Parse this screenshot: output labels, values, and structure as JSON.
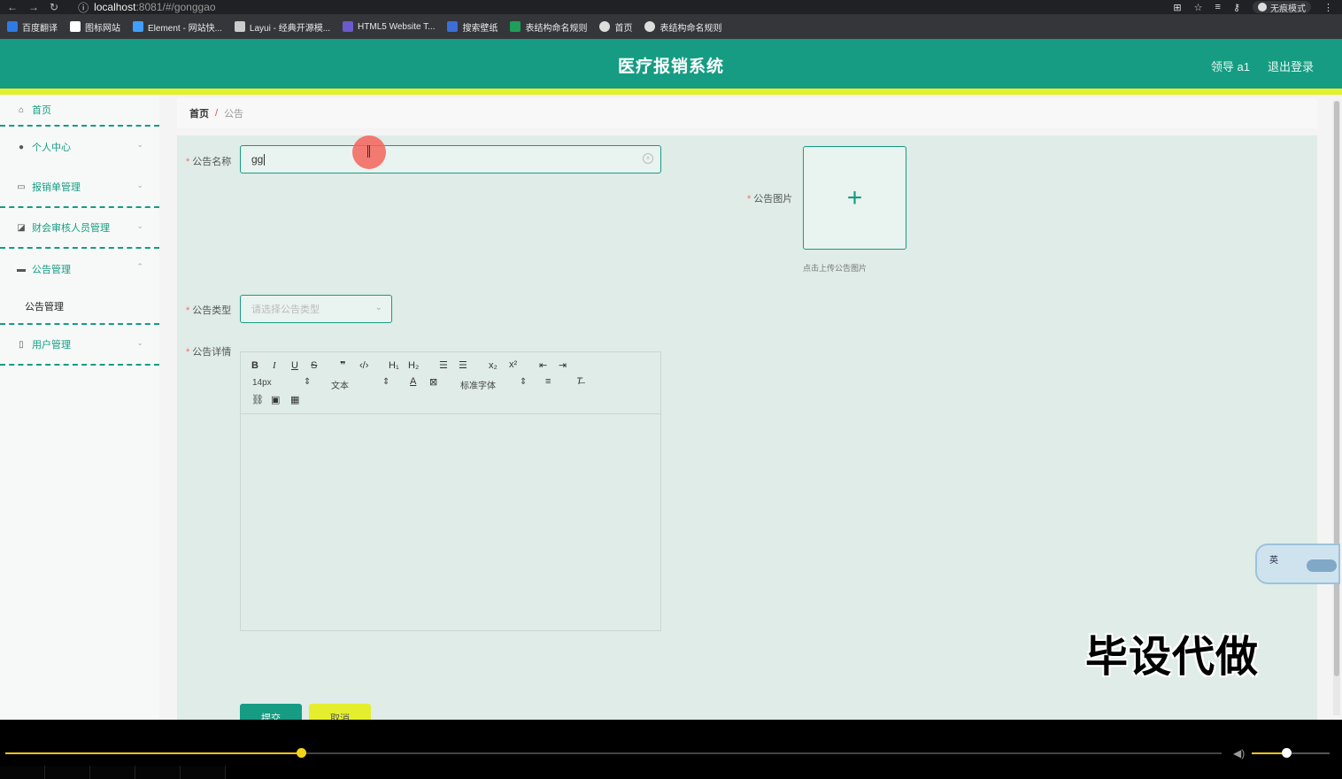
{
  "browser": {
    "url_host": "localhost",
    "url_path": ":8081/#/gonggao",
    "incognito_label": "无痕模式",
    "bookmarks": [
      {
        "label": "百度翻译",
        "color": "#2d7be5"
      },
      {
        "label": "图标网站",
        "color": "#ffffff"
      },
      {
        "label": "Element - 网站快...",
        "color": "#409eff"
      },
      {
        "label": "Layui - 经典开源模...",
        "color": "#cccccc"
      },
      {
        "label": "HTML5 Website T...",
        "color": "#6a5acd"
      },
      {
        "label": "搜索壁纸",
        "color": "#3b6fd8"
      },
      {
        "label": "表结构命名规则",
        "color": "#1e9e5a"
      },
      {
        "label": "首页",
        "color": "#dddddd"
      },
      {
        "label": "表结构命名规则",
        "color": "#dddddd"
      }
    ]
  },
  "header": {
    "title": "医疗报销系统",
    "user": "领导 a1",
    "logout": "退出登录"
  },
  "sidebar": {
    "items": [
      {
        "label": "首页",
        "icon": "home-icon"
      },
      {
        "label": "个人中心",
        "icon": "user-icon"
      },
      {
        "label": "报销单管理",
        "icon": "message-icon"
      },
      {
        "label": "财会审核人员管理",
        "icon": "chart-icon"
      },
      {
        "label": "公告管理",
        "icon": "comment-icon"
      },
      {
        "label": "用户管理",
        "icon": "mic-icon"
      }
    ],
    "submenu": {
      "label": "公告管理"
    }
  },
  "breadcrumb": {
    "home": "首页",
    "separator": "/",
    "current": "公告"
  },
  "form": {
    "name_label": "公告名称",
    "name_value": "gg",
    "image_label": "公告图片",
    "upload_plus": "+",
    "upload_tip": "点击上传公告图片",
    "type_label": "公告类型",
    "type_placeholder": "请选择公告类型",
    "detail_label": "公告详情",
    "submit": "提交",
    "cancel": "取消"
  },
  "editor": {
    "font_size": "14px",
    "block_type": "文本",
    "font_family": "标准字体"
  },
  "overlays": {
    "ime_text": "英",
    "watermark": "毕设代做"
  },
  "player": {
    "progress_fraction": 0.243,
    "volume_fraction": 0.44
  },
  "colors": {
    "primary": "#169c83",
    "accent": "#e5ee2d",
    "required": "#f56c6c"
  }
}
